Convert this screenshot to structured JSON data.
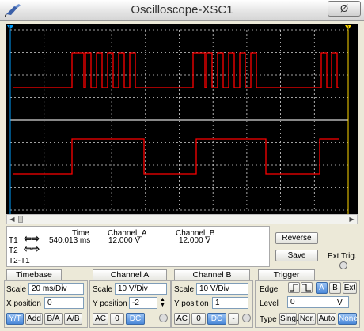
{
  "window": {
    "title": "Oscilloscope-XSC1",
    "close_glyph": "Ø"
  },
  "colors": {
    "screen_bg": "#000000",
    "grid": "#d8d8d8",
    "trace": "#ff0000",
    "cursor_t1": "#00a0ff",
    "cursor_t2": "#ffd800"
  },
  "readout": {
    "headers": {
      "time": "Time",
      "channel_a": "Channel_A",
      "channel_b": "Channel_B"
    },
    "t1_label": "T1",
    "t2_label": "T2",
    "t2_t1_label": "T2-T1",
    "t1": {
      "time": "540.013 ms",
      "channel_a": "12.000 V",
      "channel_b": "12.000 V"
    },
    "reverse_button": "Reverse",
    "save_button": "Save",
    "ext_trig_label": "Ext Trig."
  },
  "timebase": {
    "header": "Timebase",
    "scale_label": "Scale",
    "scale_value": "20 ms/Div",
    "xpos_label": "X position",
    "xpos_value": "0",
    "buttons": [
      "Y/T",
      "Add",
      "B/A",
      "A/B"
    ],
    "active_button": "Y/T"
  },
  "channel_a": {
    "header": "Channel A",
    "scale_label": "Scale",
    "scale_value": "10  V/Div",
    "ypos_label": "Y position",
    "ypos_value": "-2",
    "buttons": [
      "AC",
      "0",
      "DC"
    ],
    "active_button": "DC"
  },
  "channel_b": {
    "header": "Channel B",
    "scale_label": "Scale",
    "scale_value": "10  V/Div",
    "ypos_label": "Y position",
    "ypos_value": "1",
    "buttons": [
      "AC",
      "0",
      "DC",
      "-"
    ],
    "active_button": "DC"
  },
  "trigger": {
    "header": "Trigger",
    "edge_label": "Edge",
    "source_buttons": [
      "A",
      "B",
      "Ext"
    ],
    "active_source": "A",
    "level_label": "Level",
    "level_value": "0",
    "level_unit": "V",
    "type_label": "Type",
    "type_buttons": [
      "Sing.",
      "Nor.",
      "Auto",
      "None"
    ],
    "active_type": "None"
  },
  "icons": {
    "app": "scope-probe-icon",
    "t1_arrows": "left-right-arrows-icon",
    "t2_arrows": "left-right-arrows-icon",
    "edge_rise": "rising-edge-icon",
    "edge_fall": "falling-edge-icon"
  }
}
